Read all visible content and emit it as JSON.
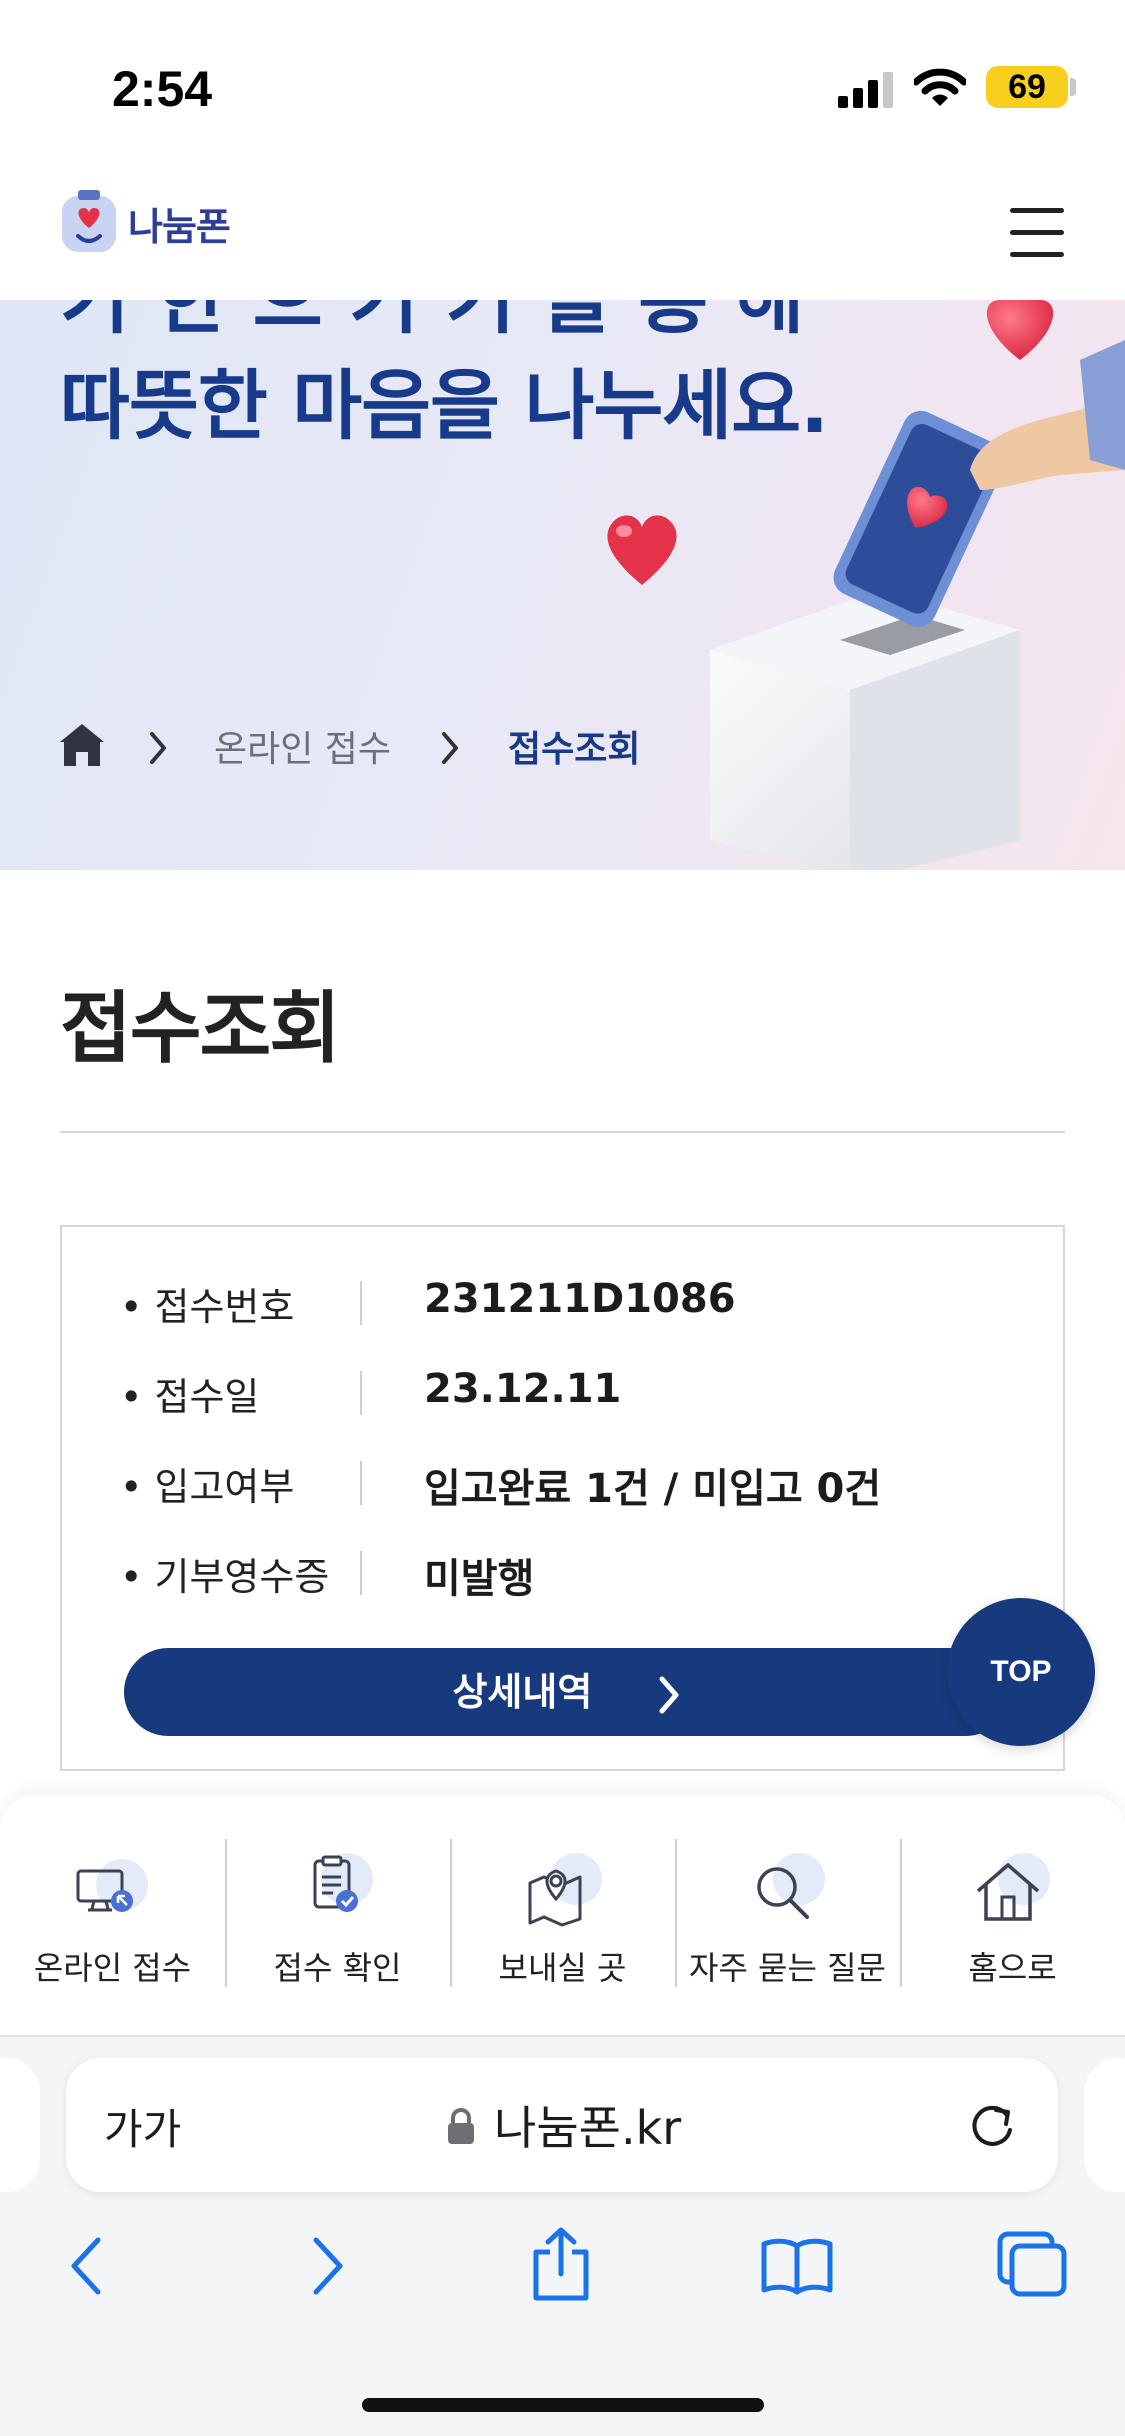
{
  "status_bar": {
    "time": "2:54",
    "battery": "69"
  },
  "header": {
    "logo_text": "나눔폰",
    "menu_icon": "hamburger-menu-icon"
  },
  "hero": {
    "cut_title": "기 한 으 기 기 을 통 해",
    "title": "따뜻한 마음을 나누세요.",
    "breadcrumb": [
      "온라인 접수",
      "접수조회"
    ]
  },
  "page_title": "접수조회",
  "receipt": {
    "rows": [
      {
        "label": "접수번호",
        "value": "231211D1086"
      },
      {
        "label": "접수일",
        "value": "23.12.11"
      },
      {
        "label": "입고여부",
        "value": "입고완료 1건 / 미입고 0건"
      },
      {
        "label": "기부영수증",
        "value": "미발행"
      }
    ],
    "detail_button": "상세내역"
  },
  "top_button": "TOP",
  "quick_nav": [
    {
      "label": "온라인 접수",
      "icon": "monitor-icon"
    },
    {
      "label": "접수 확인",
      "icon": "clipboard-check-icon"
    },
    {
      "label": "보내실 곳",
      "icon": "map-pin-icon"
    },
    {
      "label": "자주 묻는 질문",
      "icon": "search-icon"
    },
    {
      "label": "홈으로",
      "icon": "home-icon"
    }
  ],
  "browser": {
    "text_size": "가가",
    "url": "나눔폰.kr"
  },
  "colors": {
    "brand": "#173a7e",
    "hero_text": "#173a8a",
    "accent": "#e8354a"
  }
}
